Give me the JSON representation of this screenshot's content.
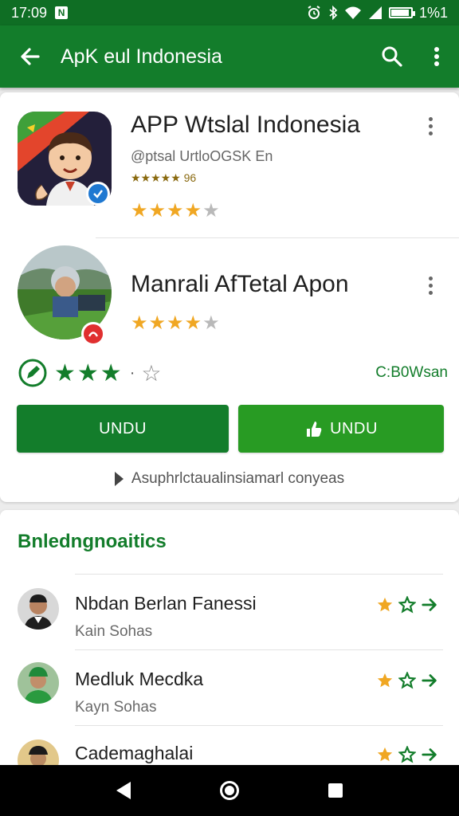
{
  "status_bar": {
    "time": "17:09",
    "notif_letter": "N",
    "battery_text": "1%1",
    "battery_level": 0.9
  },
  "app_bar": {
    "title": "ApK eul Indonesia"
  },
  "apps": [
    {
      "title": "APP Wtslal Indonesia",
      "subtitle": "@ptsal UrtloOGSK En",
      "mini_rating": "★★★★★ 96",
      "rating": 4
    },
    {
      "title": "Manrali AfTetal Apon",
      "rating": 4
    }
  ],
  "summary": {
    "count": "C:B0Wsan"
  },
  "buttons": {
    "primary_label": "UNDU",
    "secondary_label": "UNDU"
  },
  "more_link": "Asuphrlctaualinsiamarl conyeas",
  "section": {
    "title": "Bnledngnoaitics"
  },
  "people": [
    {
      "name": "Nbdan Berlan Fanessi",
      "subtitle": "Kain Sohas"
    },
    {
      "name": "Medluk Mecdka",
      "subtitle": "Kayn Sohas"
    },
    {
      "name": "Cademaghalai",
      "subtitle": ""
    }
  ],
  "colors": {
    "brand": "#137d2b",
    "status": "#0f6e24",
    "accent_green": "#289b23",
    "star": "#f0a723"
  },
  "icons": [
    "back-arrow-icon",
    "search-icon",
    "more-vert-icon",
    "pencil-icon",
    "star-icon",
    "play-icon",
    "arrow-right-icon"
  ]
}
